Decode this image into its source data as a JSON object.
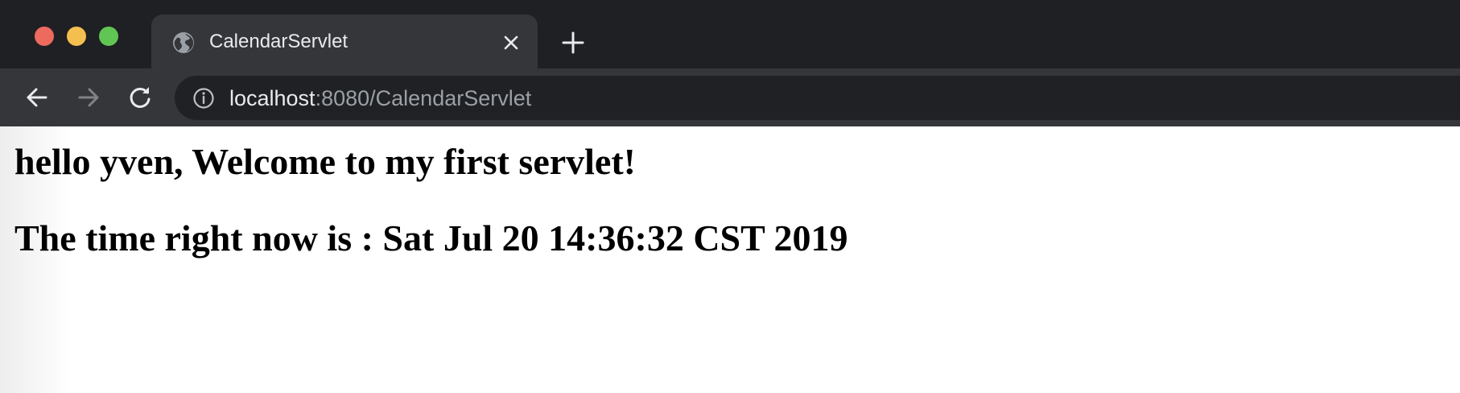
{
  "browser": {
    "tab": {
      "title": "CalendarServlet",
      "favicon": "globe-icon"
    },
    "toolbar": {
      "back_icon": "arrow-left-icon",
      "forward_icon": "arrow-right-icon",
      "reload_icon": "reload-icon",
      "address": {
        "host": "localhost",
        "path": ":8080/CalendarServlet",
        "info_icon": "info-icon"
      }
    },
    "new_tab_icon": "plus-icon",
    "colors": {
      "titlebar": "#1f2023",
      "tab": "#35363a",
      "omnibox": "#202124",
      "traffic_red": "#ed6a5e",
      "traffic_yellow": "#f5bf4f",
      "traffic_green": "#61c554"
    }
  },
  "page": {
    "greeting": "hello yven, Welcome to my first servlet!",
    "time_line": "The time right now is : Sat Jul 20 14:36:32 CST 2019"
  }
}
